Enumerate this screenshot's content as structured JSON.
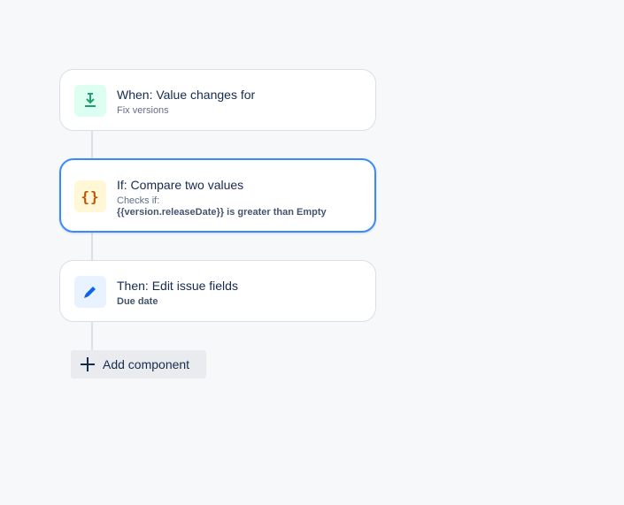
{
  "rule": {
    "trigger": {
      "title": "When: Value changes for",
      "subtitle": "Fix versions",
      "icon": "field-value-changed-icon",
      "icon_color": "#22a06b",
      "icon_bg": "#dcfff1"
    },
    "condition": {
      "title": "If: Compare two values",
      "subtitle_line1": "Checks if:",
      "subtitle_line2": "{{version.releaseDate}} is greater than Empty",
      "icon": "curly-braces-icon",
      "icon_color": "#c25100",
      "icon_bg": "#fff7d6",
      "icon_text": "{}"
    },
    "action": {
      "title": "Then: Edit issue fields",
      "subtitle": "Due date",
      "icon": "pencil-edit-icon",
      "icon_color": "#0c66e4",
      "icon_bg": "#e9f2ff"
    },
    "add_component_label": "Add component"
  },
  "colors": {
    "selected_border": "#388bff",
    "connector": "#dcdfe4",
    "background": "#f7f8f9"
  }
}
